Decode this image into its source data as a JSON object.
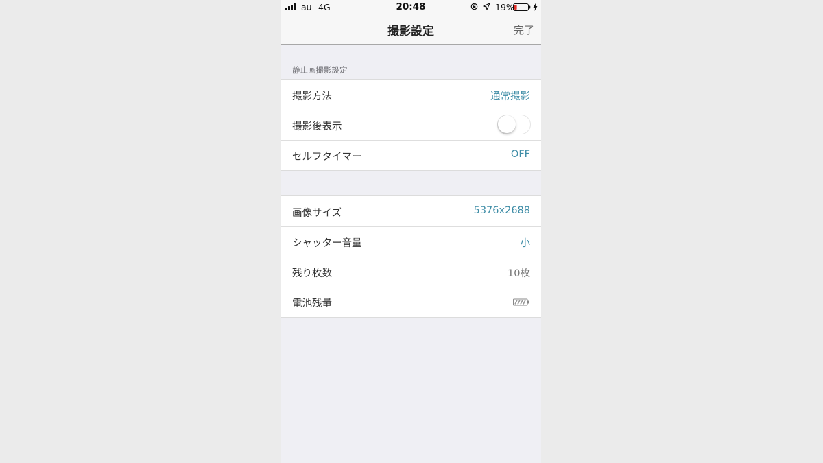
{
  "status_bar": {
    "carrier": "au",
    "network": "4G",
    "time": "20:48",
    "battery_percent": "19%",
    "battery_level": 0.19,
    "icons": [
      "signal-icon",
      "orientation-lock-icon",
      "location-icon",
      "battery-icon",
      "charging-bolt-icon"
    ]
  },
  "nav": {
    "title": "撮影設定",
    "done_label": "完了"
  },
  "still_section": {
    "header": "静止画撮影設定",
    "rows": [
      {
        "label": "撮影方法",
        "value": "通常撮影"
      },
      {
        "label": "撮影後表示",
        "toggle_on": false
      },
      {
        "label": "セルフタイマー",
        "value": "OFF"
      }
    ]
  },
  "info_section": {
    "rows": [
      {
        "label": "画像サイズ",
        "value": "5376x2688"
      },
      {
        "label": "シャッター音量",
        "value": "小"
      },
      {
        "label": "残り枚数",
        "value": "10枚"
      },
      {
        "label": "電池残量",
        "icon": "camera-battery-icon"
      }
    ]
  },
  "colors": {
    "accent": "#3d8ca6",
    "background": "#efeff4",
    "battery_low": "#e0312b"
  }
}
